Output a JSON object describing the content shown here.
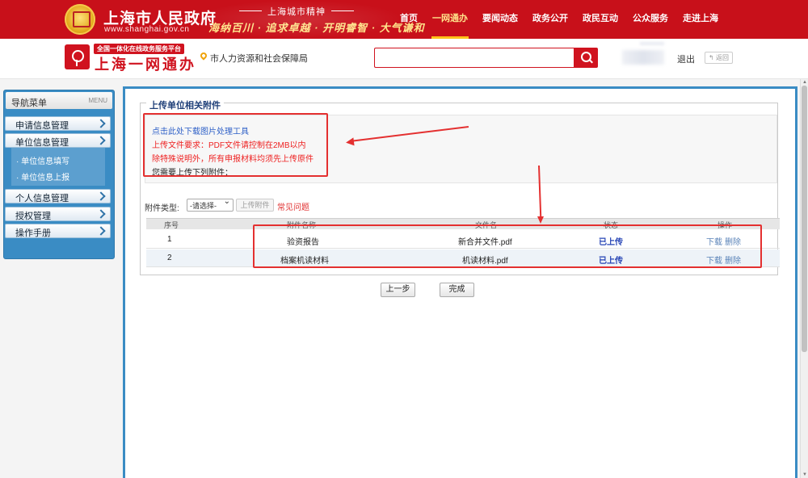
{
  "header": {
    "gov_title": "上海市人民政府",
    "gov_url": "www.shanghai.gov.cn",
    "spirit_title": "上海城市精神",
    "spirit_text": "海纳百川 · 追求卓越 · 开明睿智 · 大气谦和",
    "nav": [
      {
        "label": "首页",
        "active": false
      },
      {
        "label": "一网通办",
        "active": true
      },
      {
        "label": "要闻动态",
        "active": false
      },
      {
        "label": "政务公开",
        "active": false
      },
      {
        "label": "政民互动",
        "active": false
      },
      {
        "label": "公众服务",
        "active": false
      },
      {
        "label": "走进上海",
        "active": false
      }
    ]
  },
  "subheader": {
    "slogan": "全国一体化在线政务服务平台",
    "platform": "上海一网通办",
    "department": "市人力资源和社会保障局",
    "search_value": "",
    "logout": "退出",
    "back": "返回"
  },
  "sidebar": {
    "title": "导航菜单",
    "menu_tag": "MENU",
    "items": [
      {
        "label": "申请信息管理"
      },
      {
        "label": "单位信息管理"
      },
      {
        "label": "个人信息管理"
      },
      {
        "label": "授权管理"
      },
      {
        "label": "操作手册"
      }
    ],
    "sub_items": [
      {
        "label": "单位信息填写"
      },
      {
        "label": "单位信息上报"
      }
    ]
  },
  "main": {
    "section_title": "上传单位相关附件",
    "notice": {
      "download_link": "点击此处下载图片处理工具",
      "requirement": "上传文件要求：PDF文件请控制在2MB以内",
      "original_rule": "除特殊说明外，所有申报材料均须先上传原件",
      "need_upload": "您需要上传下列附件："
    },
    "attach_type_label": "附件类型:",
    "attach_type_selected": "-请选择-",
    "upload_button": "上传附件",
    "faq_link": "常见问题",
    "table": {
      "headers": [
        "序号",
        "附件名称",
        "文件名",
        "状态",
        "操作"
      ],
      "rows": [
        {
          "no": "1",
          "name": "验资报告",
          "file": "新合并文件.pdf",
          "status": "已上传",
          "download": "下载",
          "delete": "删除"
        },
        {
          "no": "2",
          "name": "档案机读材料",
          "file": "机读材料.pdf",
          "status": "已上传",
          "download": "下载",
          "delete": "删除"
        }
      ]
    },
    "prev_button": "上一步",
    "done_button": "完成"
  },
  "colors": {
    "brand_red": "#c8101a",
    "sidebar_blue": "#3a8cc4",
    "annotation_red": "#e43030",
    "status_blue": "#2644b5"
  }
}
